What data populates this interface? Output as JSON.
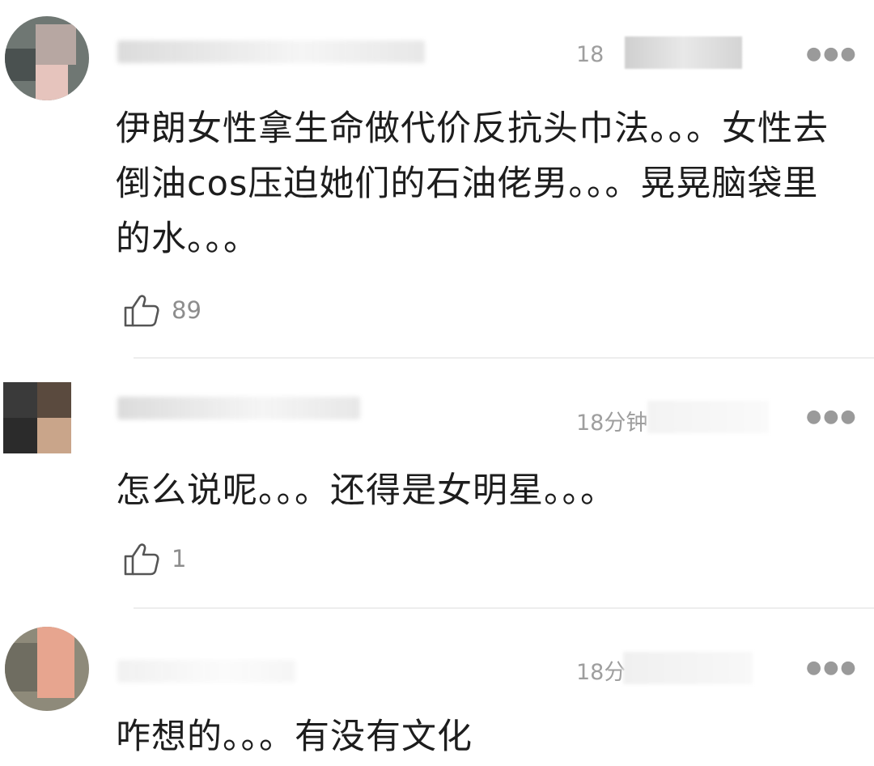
{
  "comments": [
    {
      "time": "18",
      "text": "伊朗女性拿生命做代价反抗头巾法。。。女性去倒油cos压迫她们的石油佬男。。。晃晃脑袋里的水。。。",
      "likes": "89"
    },
    {
      "time": "18分钟",
      "text": "怎么说呢。。。还得是女明星。。。",
      "likes": "1"
    },
    {
      "time": "18分",
      "text": "咋想的。。。有没有文化",
      "likes": ""
    }
  ],
  "icons": {
    "more": "more-icon",
    "like": "thumbs-up-icon"
  },
  "colors": {
    "text": "#1d1d1d",
    "meta": "#9e9e9e",
    "divider": "#ededed"
  }
}
